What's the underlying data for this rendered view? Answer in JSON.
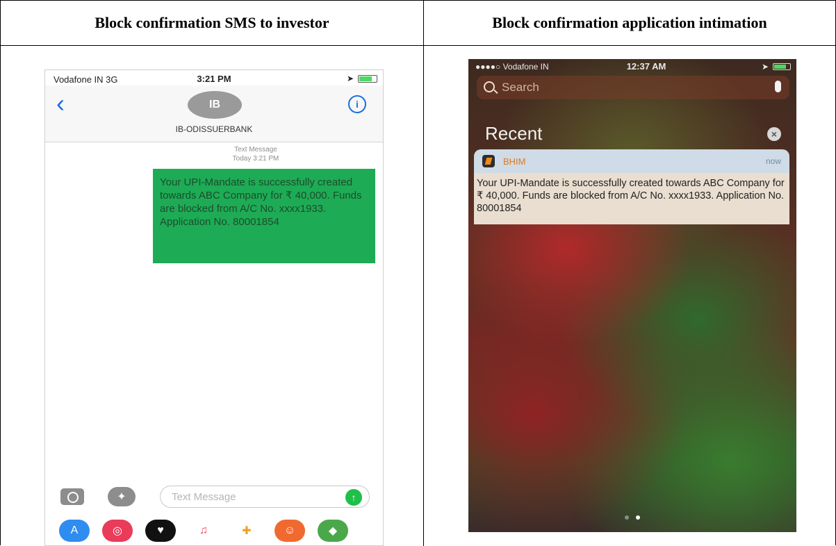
{
  "table": {
    "left_header": "Block confirmation SMS to investor",
    "right_header": "Block confirmation application intimation"
  },
  "sms_phone": {
    "status": {
      "carrier": "Vodafone IN  3G",
      "time": "3:21 PM"
    },
    "contact": {
      "avatar": "IB",
      "name": "IB-ODISSUERBANK"
    },
    "meta": {
      "line1": "Text Message",
      "line2": "Today 3:21 PM"
    },
    "message": "Your UPI-Mandate is successfully created towards ABC Company for ₹ 40,000. Funds are blocked from A/C No. xxxx1933. Application No. 80001854",
    "input_placeholder": "Text Message"
  },
  "notif_phone": {
    "status": {
      "carrier": "●●●●○ Vodafone IN",
      "time": "12:37 AM"
    },
    "search_placeholder": "Search",
    "section_title": "Recent",
    "notification": {
      "app": "BHIM",
      "time": "now",
      "body": "Your UPI-Mandate is successfully created towards ABC Company for ₹ 40,000. Funds are blocked from A/C No. xxxx1933. Application No. 80001854"
    }
  },
  "colors": {
    "sms_bubble": "#1eab56",
    "ios_blue": "#1a6fe0",
    "bhim_orange": "#e07a20"
  }
}
